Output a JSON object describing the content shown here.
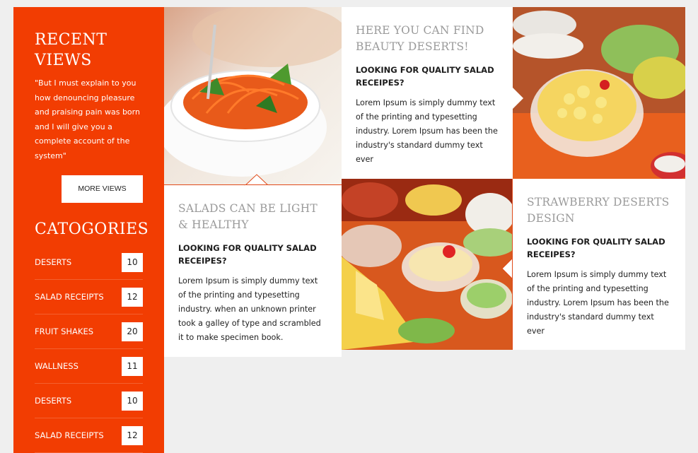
{
  "sidebar": {
    "recent_title": "RECENT VIEWS",
    "quote": "\"But I must explain to you how denouncing pleasure and praising pain was born and I will give you a complete account of the system\"",
    "more_button": "MORE VIEWS",
    "categories_title": "CATOGORIES",
    "categories": [
      {
        "label": "DESERTS",
        "count": "10"
      },
      {
        "label": "SALAD RECEIPTS",
        "count": "12"
      },
      {
        "label": "FRUIT SHAKES",
        "count": "20"
      },
      {
        "label": "WALLNESS",
        "count": "11"
      },
      {
        "label": "DESERTS",
        "count": "10"
      },
      {
        "label": "SALAD RECEIPTS",
        "count": "12"
      }
    ]
  },
  "tiles": {
    "beauty": {
      "heading": "HERE YOU CAN FIND BEAUTY DESERTS!",
      "sub": "LOOKING FOR QUALITY SALAD RECEIPES?",
      "body": "Lorem Ipsum is simply dummy text of the printing and typesetting industry. Lorem Ipsum has been the industry's standard dummy text ever"
    },
    "salads": {
      "heading": "SALADS CAN BE LIGHT & HEALTHY",
      "sub": "LOOKING FOR QUALITY SALAD RECEIPES?",
      "body": "Lorem Ipsum is simply dummy text of the printing and typesetting industry. when an unknown printer took a galley of type and scrambled it to make specimen book."
    },
    "strawberry": {
      "heading": "STRAWBERRY DESERTS DESIGN",
      "sub": "LOOKING FOR QUALITY SALAD RECEIPES?",
      "body": "Lorem Ipsum is simply dummy text of the printing and typesetting industry. Lorem Ipsum has been the industry's standard dummy text ever"
    }
  },
  "colors": {
    "accent": "#f23d02",
    "heading_gray": "#9a9a9a",
    "background": "#efefef"
  }
}
